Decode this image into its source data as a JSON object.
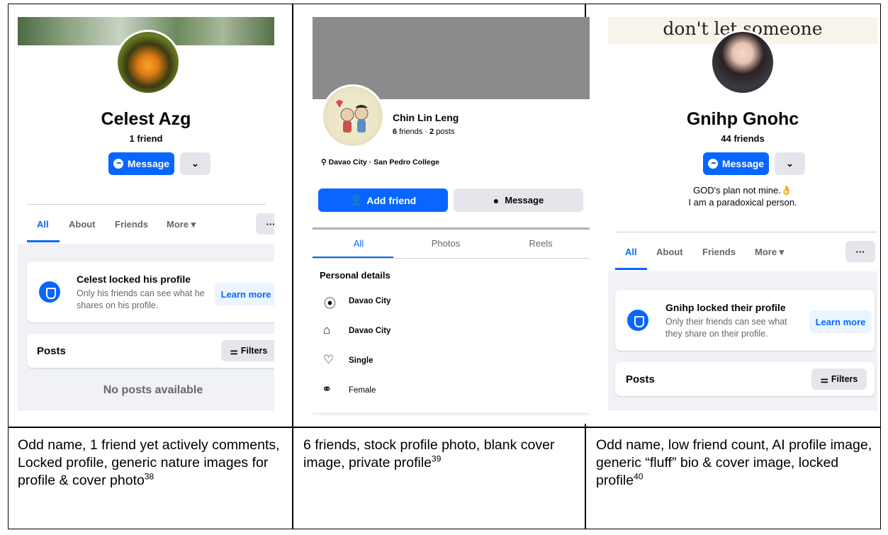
{
  "panel1": {
    "name": "Celest Azg",
    "friends": "1 friend",
    "message_label": "Message",
    "more_caret": "⌄",
    "tabs": [
      "All",
      "About",
      "Friends",
      "More ▾"
    ],
    "dots": "···",
    "lock_title": "Celest locked his profile",
    "lock_desc_1": "Only his friends can see what he",
    "lock_desc_2": "shares on his profile.",
    "learn_more": "Learn more",
    "posts": "Posts",
    "filters": "Filters",
    "no_posts": "No posts available"
  },
  "panel2": {
    "name": "Chin Lin Leng",
    "stats": "6 friends · 2 posts",
    "stats_friends_n": "6",
    "stats_friends_label": "friends",
    "stats_posts_n": "2",
    "stats_posts_label": "posts",
    "location_line": "Davao City · San Pedro College",
    "add_friend": "Add friend",
    "message": "Message",
    "tabs": [
      "All",
      "Photos",
      "Reels"
    ],
    "section_title": "Personal details",
    "details": [
      {
        "icon": "location-pin-icon",
        "text": "Davao City"
      },
      {
        "icon": "home-icon",
        "text": "Davao City"
      },
      {
        "icon": "heart-icon",
        "text": "Single"
      },
      {
        "icon": "gender-icon",
        "text": "Female"
      }
    ]
  },
  "panel3": {
    "cover_text": "don't let someone",
    "name": "Gnihp Gnohc",
    "friends": "44 friends",
    "message_label": "Message",
    "bio_1": "GOD's plan not mine.👌",
    "bio_2": "I am a paradoxical person.",
    "tabs": [
      "All",
      "About",
      "Friends",
      "More ▾"
    ],
    "dots": "···",
    "lock_title": "Gnihp locked their profile",
    "lock_desc_1": "Only their friends can see what",
    "lock_desc_2": "they share on their profile.",
    "learn_more": "Learn more",
    "posts": "Posts",
    "filters": "Filters"
  },
  "captions": {
    "c1": "Odd name, 1 friend yet actively comments, Locked profile, generic nature images for profile & cover photo",
    "c1_ref": "38",
    "c2": "6 friends, stock profile photo, blank cover image, private profile",
    "c2_ref": "39",
    "c3": "Odd name, low friend count, AI profile image, generic “fluff” bio & cover image, locked profile",
    "c3_ref": "40"
  },
  "colors": {
    "fb_blue": "#0866ff",
    "grey_bg": "#f0f2f5",
    "button_grey": "#e4e6eb"
  }
}
